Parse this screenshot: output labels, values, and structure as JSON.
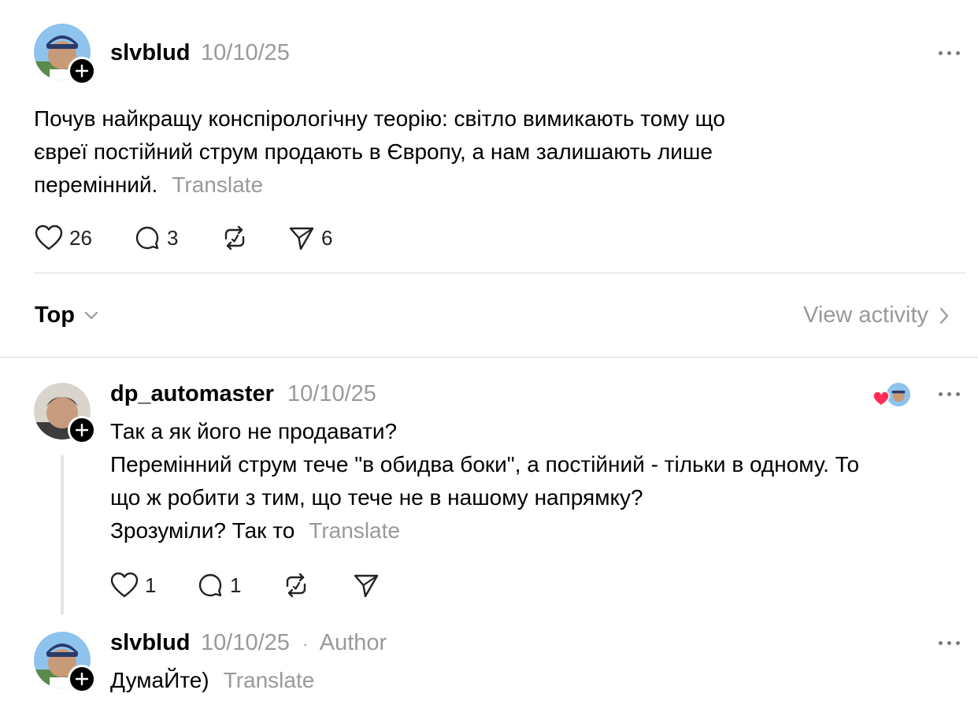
{
  "post": {
    "username": "slvblud",
    "date": "10/10/25",
    "lines": [
      "Почув найкращу конспірологічну теорію: світло вимикають тому що",
      "євреї постійний струм продають в Європу, а нам залишають лише",
      "перемінний."
    ],
    "translate": "Translate",
    "likes": "26",
    "comments": "3",
    "shares": "6"
  },
  "sort": {
    "label": "Top",
    "view_activity": "View activity"
  },
  "reply": {
    "username": "dp_automaster",
    "date": "10/10/25",
    "lines": [
      "Так а як його не продавати?",
      "Перемінний струм тече \"в обидва боки\", а постійний - тільки в одному. То",
      "що ж робити з тим, що тече не в нашому напрямку?",
      "Зрозуміли? Так то"
    ],
    "translate": "Translate",
    "likes": "1",
    "comments": "1"
  },
  "author_reply": {
    "username": "slvblud",
    "date": "10/10/25",
    "separator": "·",
    "author_label": "Author",
    "text": "ДумаЙте)",
    "translate": "Translate"
  },
  "colors": {
    "heart_badge": "#ff2d55",
    "muted_text": "#999999",
    "divider": "#dcdcdc"
  }
}
